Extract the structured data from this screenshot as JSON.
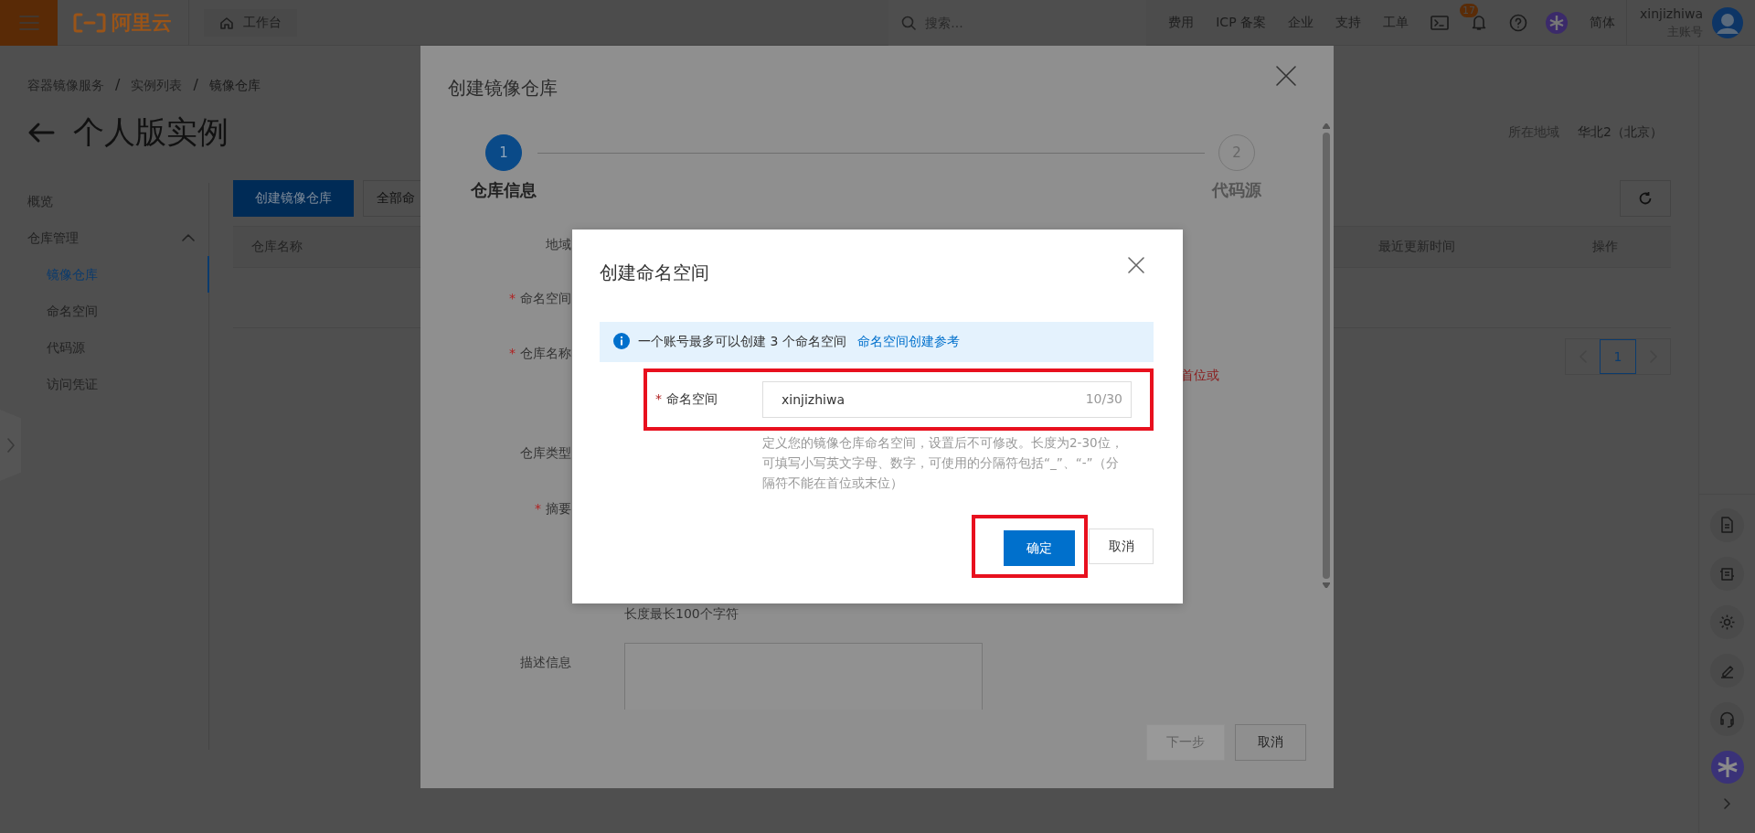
{
  "topbar": {
    "brand": "阿里云",
    "workbench": "工作台",
    "search": {
      "placeholder": "搜索..."
    },
    "links": [
      "费用",
      "ICP 备案",
      "企业",
      "支持",
      "工单"
    ],
    "notifications": {
      "count": "17"
    },
    "language": "简体",
    "user": {
      "name": "xinjizhiwa",
      "role": "主账号"
    }
  },
  "breadcrumb": [
    {
      "text": "容器镜像服务",
      "kind": "link"
    },
    {
      "text": "/",
      "kind": "separator"
    },
    {
      "text": "实例列表",
      "kind": "link"
    },
    {
      "text": "/",
      "kind": "separator"
    },
    {
      "text": "镜像仓库",
      "kind": "current"
    }
  ],
  "page_title": "个人版实例",
  "region": {
    "label": "所在地域",
    "value": "华北2（北京）"
  },
  "sidebar": {
    "items": [
      {
        "label": "概览",
        "selected": false
      },
      {
        "label": "仓库管理",
        "selected": false,
        "expanded": true,
        "children": [
          {
            "label": "镜像仓库",
            "selected": true
          },
          {
            "label": "命名空间",
            "selected": false
          },
          {
            "label": "代码源",
            "selected": false
          },
          {
            "label": "访问凭证",
            "selected": false
          }
        ]
      }
    ]
  },
  "toolbar": {
    "buttons": [
      {
        "label": "创建镜像仓库",
        "kind": "primary"
      },
      {
        "label": "全部命",
        "kind": "default"
      }
    ]
  },
  "table": {
    "columns": [
      "仓库名称",
      "最近更新时间",
      "操作"
    ]
  },
  "pagination": {
    "pages": [
      {
        "label": "1",
        "selected": true
      }
    ]
  },
  "repo_dialog": {
    "title": "创建镜像仓库",
    "steps": [
      {
        "number": "1",
        "label": "仓库信息",
        "selected": true
      },
      {
        "number": "2",
        "label": "代码源",
        "selected": false
      }
    ],
    "fields": [
      {
        "label": "地域"
      },
      {
        "label": "命名空间",
        "required_mark": "*"
      },
      {
        "label": "仓库名称",
        "required_mark": "*",
        "error": "首位或"
      },
      {
        "label": "仓库类型"
      },
      {
        "label": "摘要",
        "required_mark": "*",
        "hint": "长度最长100个字符"
      },
      {
        "label": "描述信息",
        "kind": "textarea"
      }
    ],
    "buttons": [
      {
        "label": "下一步",
        "disabled": true
      },
      {
        "label": "取消",
        "disabled": false
      }
    ]
  },
  "namespace_dialog": {
    "title": "创建命名空间",
    "notice": {
      "text": "一个账号最多可以创建 3 个命名空间",
      "link": "命名空间创建参考"
    },
    "field": {
      "label": "命名空间",
      "required_mark": "*",
      "value": "xinjizhiwa",
      "counter": "10/30",
      "highlighted": true,
      "hint": "定义您的镜像仓库命名空间，设置后不可修改。长度为2-30位，可填写小写英文字母、数字，可使用的分隔符包括“_”、“-”（分隔符不能在首位或末位）"
    },
    "buttons": [
      {
        "label": "确定",
        "kind": "primary",
        "highlighted": true
      },
      {
        "label": "取消",
        "kind": "default",
        "highlighted": false
      }
    ]
  }
}
